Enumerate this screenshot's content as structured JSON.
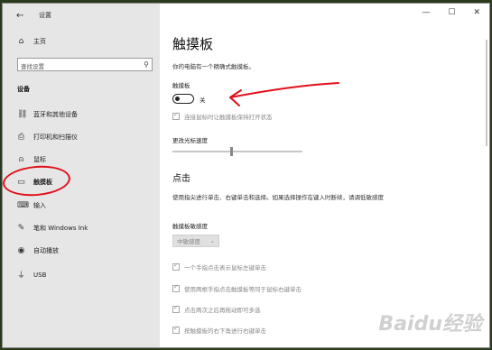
{
  "titlebar": {
    "back_icon": "back-arrow-icon",
    "title": "设置",
    "minimize": "—",
    "maximize": "☐",
    "close": "✕"
  },
  "sidebar": {
    "home_label": "主页",
    "search_placeholder": "查找设置",
    "section_title": "设备",
    "items": [
      {
        "label": "蓝牙和其他设备",
        "icon": "bluetooth-icon",
        "glyph": "⛓"
      },
      {
        "label": "打印机和扫描仪",
        "icon": "printer-icon",
        "glyph": "⎙"
      },
      {
        "label": "鼠标",
        "icon": "mouse-icon",
        "glyph": "⍝"
      },
      {
        "label": "触摸板",
        "icon": "touchpad-icon",
        "glyph": "▭"
      },
      {
        "label": "输入",
        "icon": "keyboard-icon",
        "glyph": "⌨"
      },
      {
        "label": "笔和 Windows Ink",
        "icon": "pen-icon",
        "glyph": "✎"
      },
      {
        "label": "自动播放",
        "icon": "autoplay-icon",
        "glyph": "◉"
      },
      {
        "label": "USB",
        "icon": "usb-icon",
        "glyph": "⏚"
      }
    ]
  },
  "main": {
    "title": "触摸板",
    "description": "你的电脑有一个精确式触摸板。",
    "touchpad_label": "触摸板",
    "toggle_state": "关",
    "toggle_on": false,
    "mouse_check_label": "连接鼠标时让触摸板保持打开状态",
    "cursor_speed_label": "更改光标速度",
    "cursor_speed_value": 0.45,
    "taps_heading": "点击",
    "taps_description": "使用指尖进行单击、右键单击和选择。如果选择操作在键入时断续，请调低敏感度",
    "sensitivity_label": "触摸板敏感度",
    "sensitivity_value": "中敏感度",
    "checkboxes": [
      "一个手指点击表示鼠标左键单击",
      "使用两根手指点击触摸板等同于鼠标右键单击",
      "点击两次之后再拖动即可多选",
      "按触摸板的右下角进行右键单击"
    ]
  },
  "annotation_color": "#e0101a",
  "watermark": "Baidu经验"
}
